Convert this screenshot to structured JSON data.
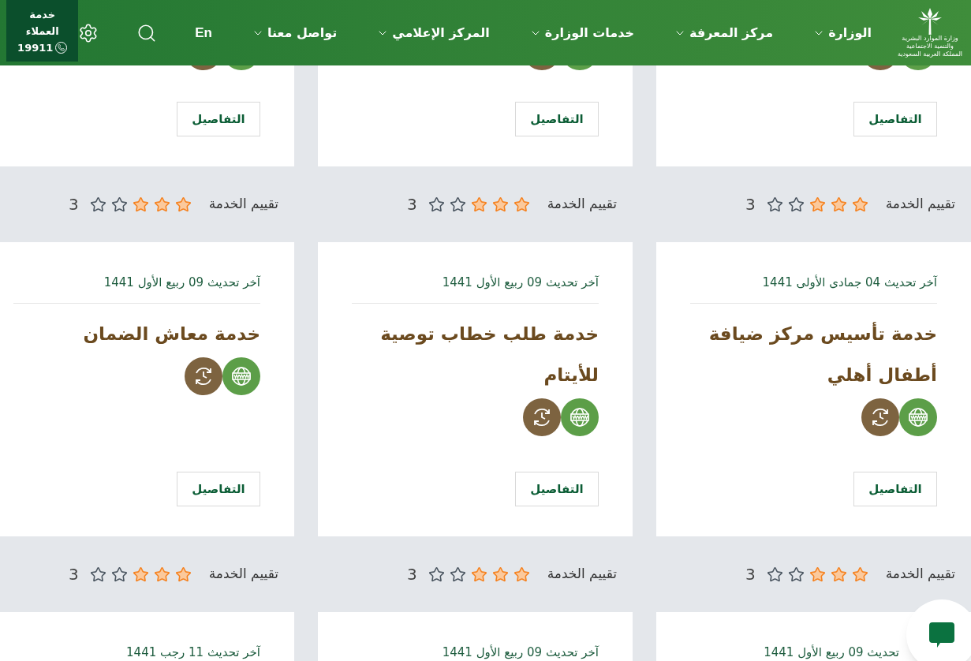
{
  "header": {
    "logo_lines": [
      "وزارة الموارد البشرية",
      "والتنمية الاجتماعية",
      "المملكة العربية السعودية"
    ],
    "nav": [
      {
        "label": "الوزارة"
      },
      {
        "label": "مركز المعرفة"
      },
      {
        "label": "خدمات الوزارة"
      },
      {
        "label": "المركز الإعلامي"
      },
      {
        "label": "تواصل معنا"
      }
    ],
    "language": "En",
    "customer_service": {
      "label": "خدمة العملاء",
      "number": "19911"
    }
  },
  "cards": [
    {
      "details": "التفاصيل",
      "rating": {
        "label": "تقييم الخدمة",
        "stars": 3,
        "value": "3"
      }
    },
    {
      "details": "التفاصيل",
      "rating": {
        "label": "تقييم الخدمة",
        "stars": 3,
        "value": "3"
      }
    },
    {
      "details": "التفاصيل",
      "rating": {
        "label": "تقييم الخدمة",
        "stars": 3,
        "value": "3"
      }
    },
    {
      "date": "آخر تحديث 04 جمادى الأولى 1441",
      "title": "خدمة تأسيس مركز ضيافة أطفال أهلي",
      "details": "التفاصيل",
      "rating": {
        "label": "تقييم الخدمة",
        "stars": 3,
        "value": "3"
      }
    },
    {
      "date": "آخر تحديث 09 ربيع الأول 1441",
      "title": "خدمة طلب خطاب توصية للأيتام",
      "details": "التفاصيل",
      "rating": {
        "label": "تقييم الخدمة",
        "stars": 3,
        "value": "3"
      }
    },
    {
      "date": "آخر تحديث 09 ربيع الأول 1441",
      "title": "خدمة معاش الضمان",
      "details": "التفاصيل",
      "rating": {
        "label": "تقييم الخدمة",
        "stars": 3,
        "value": "3"
      }
    },
    {
      "date": "تحديث 09 ربيع الأول 1441"
    },
    {
      "date": "آخر تحديث 09 ربيع الأول 1441"
    },
    {
      "date": "آخر تحديث 11 رجب 1441"
    }
  ]
}
